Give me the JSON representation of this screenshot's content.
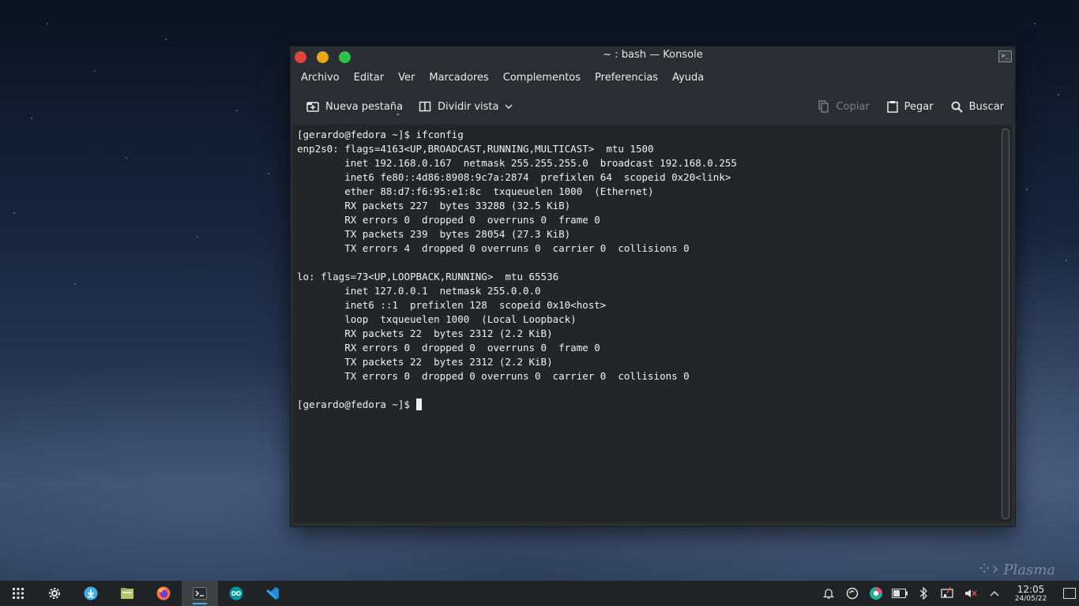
{
  "window": {
    "title": "~ : bash — Konsole",
    "menu": [
      "Archivo",
      "Editar",
      "Ver",
      "Marcadores",
      "Complementos",
      "Preferencias",
      "Ayuda"
    ],
    "toolbar": {
      "new_tab": "Nueva pestaña",
      "split_view": "Dividir vista",
      "copy": "Copiar",
      "paste": "Pegar",
      "search": "Buscar"
    }
  },
  "terminal": {
    "lines": [
      "[gerardo@fedora ~]$ ifconfig",
      "enp2s0: flags=4163<UP,BROADCAST,RUNNING,MULTICAST>  mtu 1500",
      "        inet 192.168.0.167  netmask 255.255.255.0  broadcast 192.168.0.255",
      "        inet6 fe80::4d86:8908:9c7a:2874  prefixlen 64  scopeid 0x20<link>",
      "        ether 88:d7:f6:95:e1:8c  txqueuelen 1000  (Ethernet)",
      "        RX packets 227  bytes 33288 (32.5 KiB)",
      "        RX errors 0  dropped 0  overruns 0  frame 0",
      "        TX packets 239  bytes 28054 (27.3 KiB)",
      "        TX errors 4  dropped 0 overruns 0  carrier 0  collisions 0",
      "",
      "lo: flags=73<UP,LOOPBACK,RUNNING>  mtu 65536",
      "        inet 127.0.0.1  netmask 255.0.0.0",
      "        inet6 ::1  prefixlen 128  scopeid 0x10<host>",
      "        loop  txqueuelen 1000  (Local Loopback)",
      "        RX packets 22  bytes 2312 (2.2 KiB)",
      "        RX errors 0  dropped 0  overruns 0  frame 0",
      "        TX packets 22  bytes 2312 (2.2 KiB)",
      "        TX errors 0  dropped 0 overruns 0  carrier 0  collisions 0",
      ""
    ],
    "prompt": "[gerardo@fedora ~]$ "
  },
  "taskbar": {
    "apps": [
      "app-launcher-icon",
      "settings-icon",
      "downloader-icon",
      "files-icon",
      "firefox-icon",
      "terminal-icon",
      "arduino-icon",
      "vscode-icon"
    ],
    "active_app": "terminal-icon",
    "clock": {
      "time": "12:05",
      "date": "24/05/22"
    }
  },
  "wallpaper": {
    "watermark": "Plasma"
  }
}
